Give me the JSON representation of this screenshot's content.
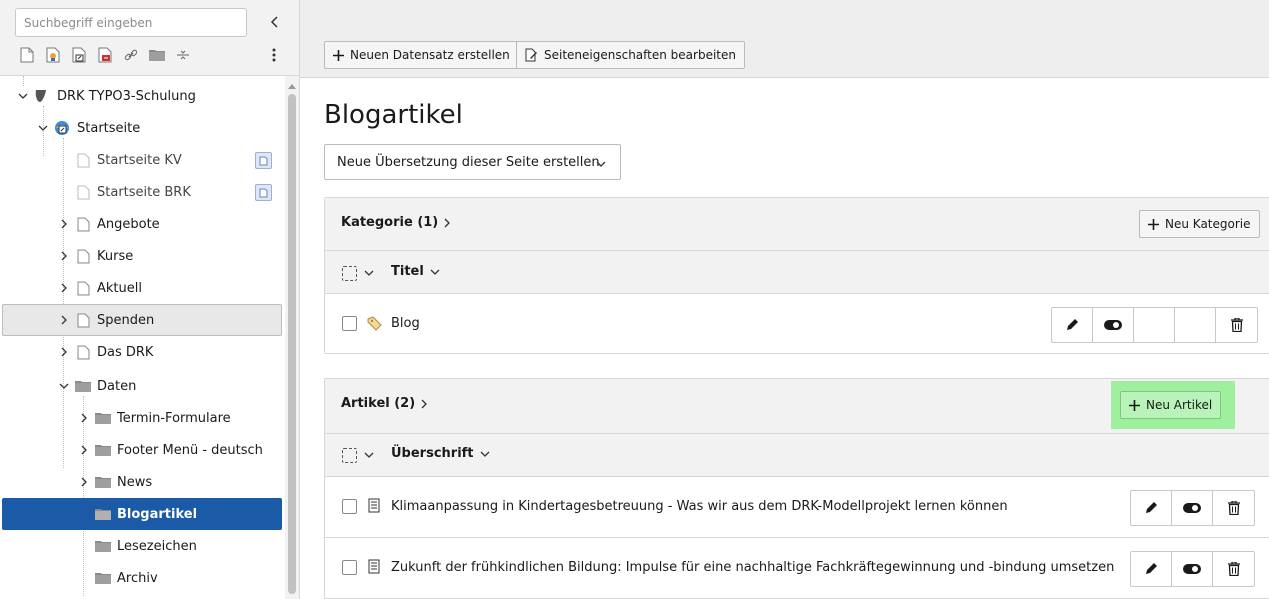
{
  "sidebar": {
    "search": {
      "placeholder": "Suchbegriff eingeben"
    },
    "toolbar_icons": [
      "new-page-icon",
      "new-page-restricted-icon",
      "new-page-shortcut-icon",
      "new-page-external-icon",
      "link-icon",
      "folder-icon",
      "divider-icon"
    ],
    "tree": {
      "root": "DRK TYPO3-Schulung",
      "startseite": "Startseite",
      "items": [
        {
          "label": "Startseite KV"
        },
        {
          "label": "Startseite BRK"
        },
        {
          "label": "Angebote"
        },
        {
          "label": "Kurse"
        },
        {
          "label": "Aktuell"
        },
        {
          "label": "Spenden"
        },
        {
          "label": "Das DRK"
        },
        {
          "label": "Daten"
        },
        {
          "label": "Termin-Formulare"
        },
        {
          "label": "Footer Menü - deutsch"
        },
        {
          "label": "News"
        },
        {
          "label": "Blogartikel"
        },
        {
          "label": "Lesezeichen"
        },
        {
          "label": "Archiv"
        }
      ]
    }
  },
  "toolbar": {
    "new_record": "Neuen Datensatz erstellen",
    "edit_page": "Seiteneigenschaften bearbeiten"
  },
  "page": {
    "title": "Blogartikel",
    "translation_select": "Neue Übersetzung dieser Seite erstellen"
  },
  "kategorie": {
    "title": "Kategorie (1)",
    "new_button": "Neu Kategorie",
    "column": "Titel",
    "rows": [
      {
        "label": "Blog"
      }
    ]
  },
  "artikel": {
    "title": "Artikel (2)",
    "new_button": "Neu Artikel",
    "column": "Überschrift",
    "rows": [
      {
        "label": "Klimaanpassung in Kindertagesbetreuung - Was wir aus dem DRK-Modellprojekt lernen können"
      },
      {
        "label": "Zukunft der frühkindlichen Bildung: Impulse für eine nachhaltige Fachkräftegewinnung und -bindung umsetzen"
      }
    ]
  },
  "colors": {
    "selected": "#1a5aa6",
    "highlight": "#9ef09e",
    "panel_bg": "#f2f2f2"
  }
}
